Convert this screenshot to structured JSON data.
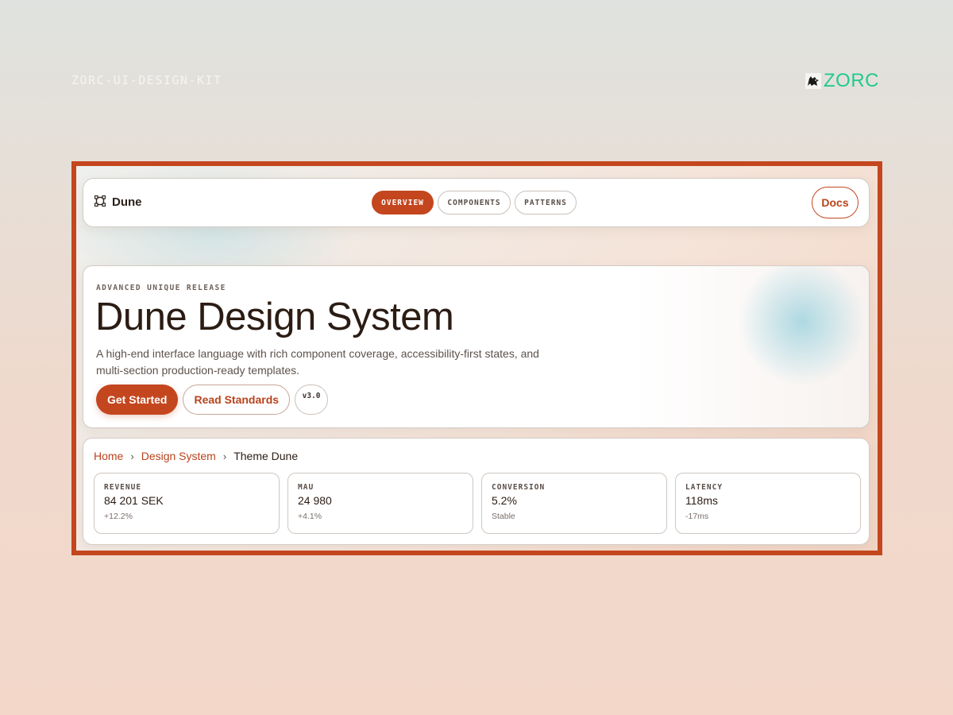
{
  "page": {
    "kit_label": "ZORC-UI-DESIGN-KIT",
    "brand_name": "ZORC"
  },
  "nav": {
    "brand": "Dune",
    "tabs": [
      {
        "label": "OVERVIEW",
        "active": true
      },
      {
        "label": "COMPONENTS",
        "active": false
      },
      {
        "label": "PATTERNS",
        "active": false
      }
    ],
    "docs_label": "Docs"
  },
  "hero": {
    "eyebrow": "ADVANCED UNIQUE RELEASE",
    "title": "Dune Design System",
    "description": "A high-end interface language with rich component coverage, accessibility-first states, and multi-section production-ready templates.",
    "primary_cta": "Get Started",
    "secondary_cta": "Read Standards",
    "version": "v3.0"
  },
  "breadcrumb": {
    "items": [
      "Home",
      "Design System",
      "Theme Dune"
    ]
  },
  "stats": [
    {
      "label": "REVENUE",
      "value": "84 201 SEK",
      "delta": "+12.2%"
    },
    {
      "label": "MAU",
      "value": "24 980",
      "delta": "+4.1%"
    },
    {
      "label": "CONVERSION",
      "value": "5.2%",
      "delta": "Stable"
    },
    {
      "label": "LATENCY",
      "value": "118ms",
      "delta": "-17ms"
    }
  ],
  "colors": {
    "accent": "#c4461e",
    "brand_green": "#22c98f",
    "text_dark": "#2b1c14"
  },
  "icons": {
    "brand_mark": "wolf-logo-icon",
    "nav_brand": "frame-corners-icon",
    "breadcrumb_separator": "chevron-right-icon"
  }
}
